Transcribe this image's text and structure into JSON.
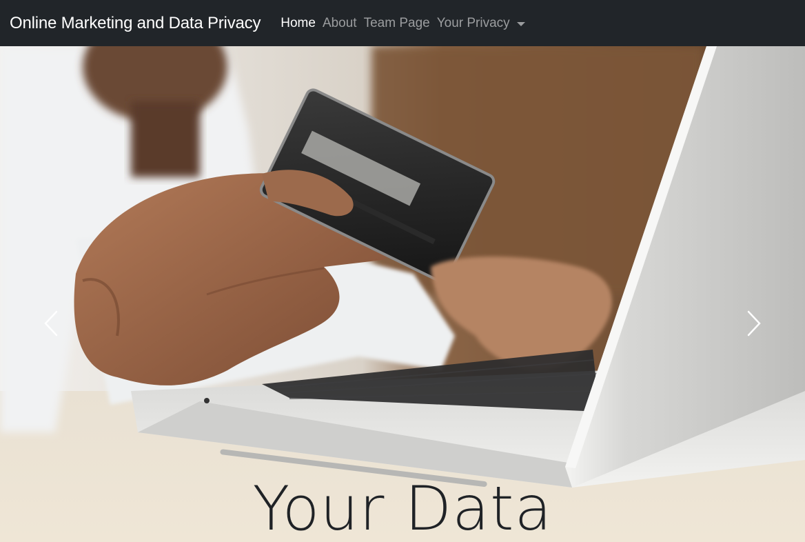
{
  "navbar": {
    "brand": "Online Marketing and Data Privacy",
    "links": [
      {
        "label": "Home",
        "active": true
      },
      {
        "label": "About",
        "active": false
      },
      {
        "label": "Team Page",
        "active": false
      },
      {
        "label": "Your Privacy",
        "active": false,
        "dropdown": true
      }
    ]
  },
  "carousel": {
    "caption_title": "Your Data",
    "prev_icon": "chevron-left-icon",
    "next_icon": "chevron-right-icon",
    "image_subject": "person holding credit card using laptop"
  },
  "colors": {
    "navbar_bg": "#212529",
    "nav_active": "#ffffff",
    "nav_inactive": "rgba(255,255,255,0.55)",
    "caption_text": "#1f2226"
  }
}
